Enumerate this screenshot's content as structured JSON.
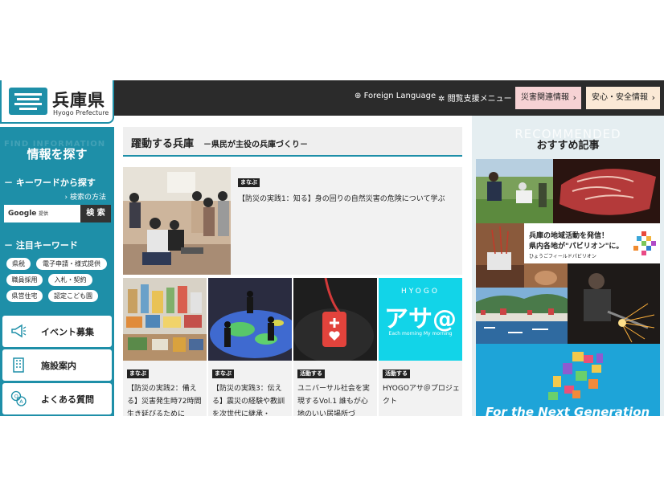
{
  "header": {
    "logo_title": "兵庫県",
    "logo_sub": "Hyogo Prefecture",
    "foreign_language": "Foreign Language",
    "reading_support": "閲覧支援メニュー",
    "disaster_button": "災害関連情報",
    "safety_button": "安心・安全情報"
  },
  "sidebar": {
    "ghost": "FIND INFORMATION",
    "title": "情報を探す",
    "keyword_heading": "キーワードから探す",
    "search_method": "検索の方法",
    "search_placeholder": "Google 提供",
    "search_button": "検 索",
    "featured_heading": "注目キーワード",
    "tags": [
      "県税",
      "電子申請・様式提供",
      "職員採用",
      "入札・契約",
      "県営住宅",
      "認定こども園"
    ],
    "buttons": [
      "イベント募集",
      "施設案内",
      "よくある質問"
    ]
  },
  "main": {
    "heading": "躍動する兵庫",
    "subheading": "－県民が主役の兵庫づくり－",
    "featured": {
      "category": "まなぶ",
      "title": "【防災の実践1：知る】身の回りの自然災害の危険について学ぶ"
    },
    "cards": [
      {
        "category": "まなぶ",
        "title": "【防災の実践2：備える】災害発生時72時間生き延びるために"
      },
      {
        "category": "まなぶ",
        "title": "【防災の実践3：伝える】震災の経験や教訓を次世代に継承・"
      },
      {
        "category": "活動する",
        "title": "ユニバーサル社会を実現するVol.1 誰もが心地のいい居場所づ"
      },
      {
        "category": "活動する",
        "title": "HYOGOアサ＠プロジェクト"
      }
    ],
    "card_logo": {
      "small": "HYOGO",
      "big": "アサ@",
      "tag": "Each morning My morning"
    }
  },
  "recommended": {
    "ghost": "RECOMMENDED",
    "title": "おすすめ記事",
    "banner_line1": "兵庫の地域活動を発信！",
    "banner_line2": "県内各地が\"パビリオン\"に。",
    "banner_line3": "ひょうごフィールドパビリオン",
    "next_gen": "For the Next Generation"
  },
  "colors": {
    "accent": "#1e8fa8",
    "header_bg": "#2b2b2b",
    "disaster_btn": "#f6d2d4",
    "safety_btn": "#fbe9d6"
  }
}
